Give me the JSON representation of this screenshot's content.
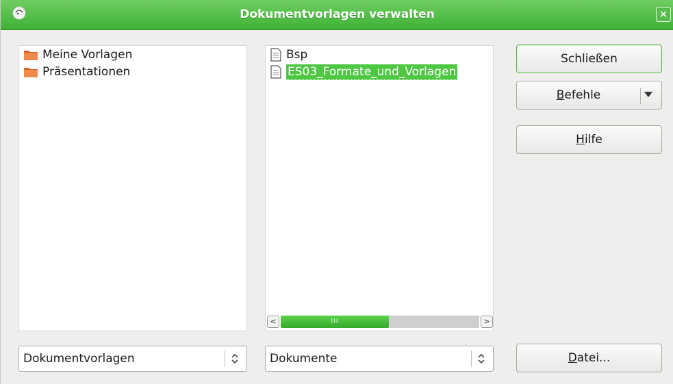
{
  "window": {
    "title": "Dokumentvorlagen verwalten",
    "close_label": "✕"
  },
  "left_list": {
    "items": [
      {
        "label": "Meine Vorlagen",
        "icon": "folder-icon"
      },
      {
        "label": "Präsentationen",
        "icon": "folder-icon"
      }
    ]
  },
  "right_list": {
    "items": [
      {
        "label": "Bsp",
        "icon": "document-icon",
        "selected": false
      },
      {
        "label": "ES03_Formate_und_Vorlagen",
        "icon": "document-icon",
        "selected": true
      }
    ],
    "scrollbar": {
      "thumb_grip": "III"
    }
  },
  "buttons": {
    "close_pre": "",
    "close_label": "Schließen",
    "commands_mn": "B",
    "commands_rest": "efehle",
    "help_mn": "H",
    "help_rest": "ilfe",
    "file_mn": "D",
    "file_rest": "atei..."
  },
  "combos": {
    "left_value": "Dokumentvorlagen",
    "right_value": "Dokumente"
  },
  "colors": {
    "titlebar": "#4fbf45",
    "selection": "#4ec743",
    "dialog_bg": "#efeeed"
  }
}
